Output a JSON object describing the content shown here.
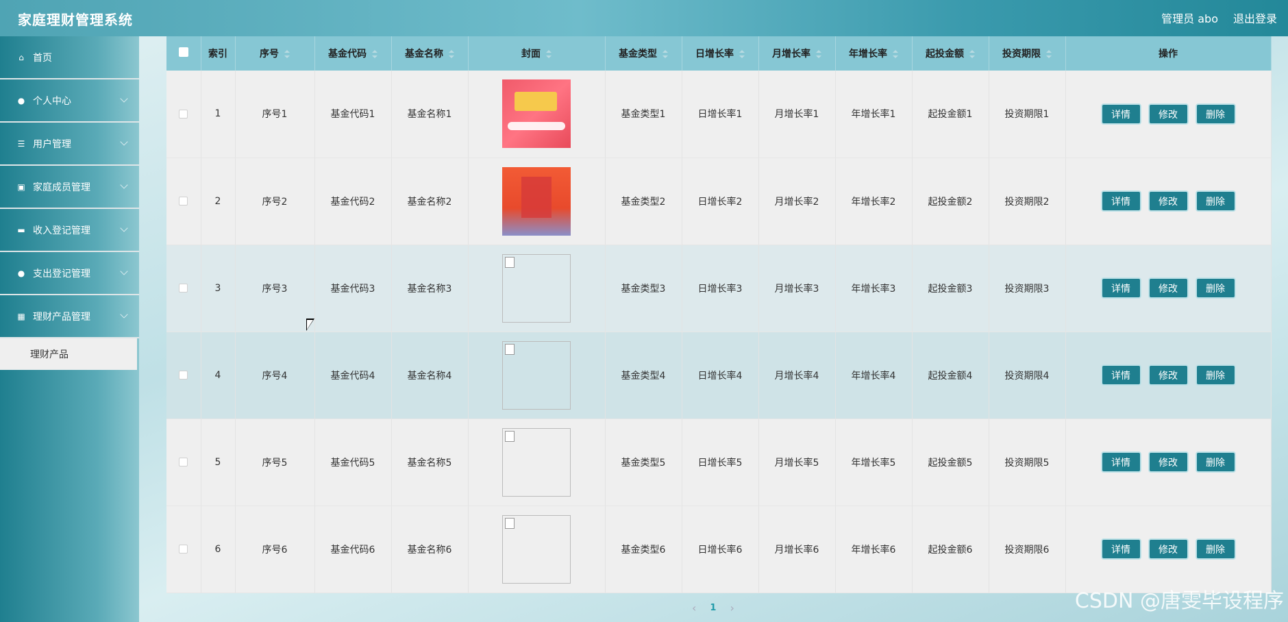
{
  "header": {
    "title": "家庭理财管理系统",
    "user_label": "管理员 abo",
    "logout_label": "退出登录"
  },
  "sidebar": {
    "items": [
      {
        "label": "首页",
        "icon": "home-icon"
      },
      {
        "label": "个人中心",
        "icon": "user-icon"
      },
      {
        "label": "用户管理",
        "icon": "sliders-icon"
      },
      {
        "label": "家庭成员管理",
        "icon": "clipboard-icon"
      },
      {
        "label": "收入登记管理",
        "icon": "briefcase-icon"
      },
      {
        "label": "支出登记管理",
        "icon": "location-pin-icon"
      },
      {
        "label": "理财产品管理",
        "icon": "grid-icon"
      }
    ],
    "sub_item": "理财产品"
  },
  "table": {
    "headers": [
      "索引",
      "序号",
      "基金代码",
      "基金名称",
      "封面",
      "基金类型",
      "日增长率",
      "月增长率",
      "年增长率",
      "起投金额",
      "投资期限",
      "操作"
    ],
    "rows": [
      {
        "index": "1",
        "seq": "序号1",
        "code": "基金代码1",
        "name": "基金名称1",
        "type": "基金类型1",
        "daily": "日增长率1",
        "monthly": "月增长率1",
        "yearly": "年增长率1",
        "min": "起投金额1",
        "term": "投资期限1"
      },
      {
        "index": "2",
        "seq": "序号2",
        "code": "基金代码2",
        "name": "基金名称2",
        "type": "基金类型2",
        "daily": "日增长率2",
        "monthly": "月增长率2",
        "yearly": "年增长率2",
        "min": "起投金额2",
        "term": "投资期限2"
      },
      {
        "index": "3",
        "seq": "序号3",
        "code": "基金代码3",
        "name": "基金名称3",
        "type": "基金类型3",
        "daily": "日增长率3",
        "monthly": "月增长率3",
        "yearly": "年增长率3",
        "min": "起投金额3",
        "term": "投资期限3"
      },
      {
        "index": "4",
        "seq": "序号4",
        "code": "基金代码4",
        "name": "基金名称4",
        "type": "基金类型4",
        "daily": "日增长率4",
        "monthly": "月增长率4",
        "yearly": "年增长率4",
        "min": "起投金额4",
        "term": "投资期限4"
      },
      {
        "index": "5",
        "seq": "序号5",
        "code": "基金代码5",
        "name": "基金名称5",
        "type": "基金类型5",
        "daily": "日增长率5",
        "monthly": "月增长率5",
        "yearly": "年增长率5",
        "min": "起投金额5",
        "term": "投资期限5"
      },
      {
        "index": "6",
        "seq": "序号6",
        "code": "基金代码6",
        "name": "基金名称6",
        "type": "基金类型6",
        "daily": "日增长率6",
        "monthly": "月增长率6",
        "yearly": "年增长率6",
        "min": "起投金额6",
        "term": "投资期限6"
      }
    ],
    "actions": {
      "detail": "详情",
      "edit": "修改",
      "delete": "删除"
    }
  },
  "pagination": {
    "current": "1"
  },
  "watermark": "CSDN @唐雯毕设程序",
  "colors": {
    "accent": "#1f7f8f",
    "header_row": "#86c7d4",
    "page_active": "#1f9aa9"
  }
}
